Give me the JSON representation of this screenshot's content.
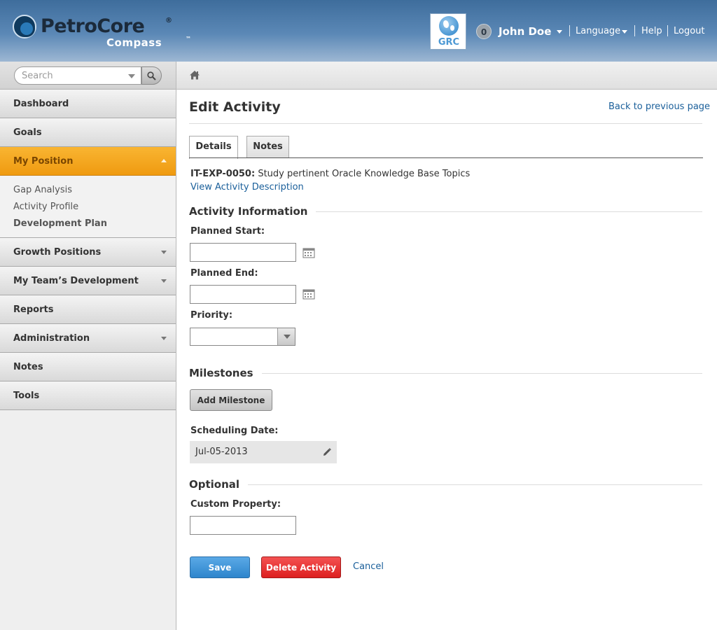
{
  "header": {
    "brand_name": "PetroCore",
    "brand_registered": "®",
    "brand_sub": "Compass",
    "brand_tm": "™",
    "grc_label": "GRC",
    "notification_count": "0",
    "user_name": "John Doe",
    "language_label": "Language",
    "help_label": "Help",
    "logout_label": "Logout"
  },
  "sidebar": {
    "search_placeholder": "Search",
    "items": [
      {
        "label": "Dashboard"
      },
      {
        "label": "Goals"
      },
      {
        "label": "My Position",
        "active": true
      },
      {
        "label": "Growth Positions"
      },
      {
        "label": "My Team’s Development"
      },
      {
        "label": "Reports"
      },
      {
        "label": "Administration"
      },
      {
        "label": "Notes"
      },
      {
        "label": "Tools"
      }
    ],
    "subitems": [
      {
        "label": "Gap Analysis"
      },
      {
        "label": "Activity Profile"
      },
      {
        "label": "Development Plan",
        "current": true
      }
    ]
  },
  "main": {
    "title": "Edit Activity",
    "back_link": "Back to previous page",
    "tabs": [
      {
        "label": "Details",
        "selected": true
      },
      {
        "label": "Notes",
        "selected": false
      }
    ],
    "activity_code": "IT-EXP-0050:",
    "activity_name": "Study pertinent Oracle Knowledge Base Topics",
    "view_description": "View Activity Description",
    "sections": {
      "activity_info": "Activity Information",
      "milestones": "Milestones",
      "optional": "Optional"
    },
    "fields": {
      "planned_start_label": "Planned Start:",
      "planned_start_value": "",
      "planned_end_label": "Planned End:",
      "planned_end_value": "",
      "priority_label": "Priority:",
      "priority_value": "",
      "scheduling_date_label": "Scheduling Date:",
      "scheduling_date_value": "Jul-05-2013",
      "custom_property_label": "Custom Property:",
      "custom_property_value": ""
    },
    "buttons": {
      "add_milestone": "Add Milestone",
      "save": "Save",
      "delete": "Delete Activity",
      "cancel": "Cancel"
    }
  },
  "colors": {
    "header_blue": "#4a79a8",
    "active_nav_orange": "#f5a623",
    "link_blue": "#1a5f9a",
    "save_blue": "#3a90d4",
    "delete_red": "#e52e2e"
  }
}
